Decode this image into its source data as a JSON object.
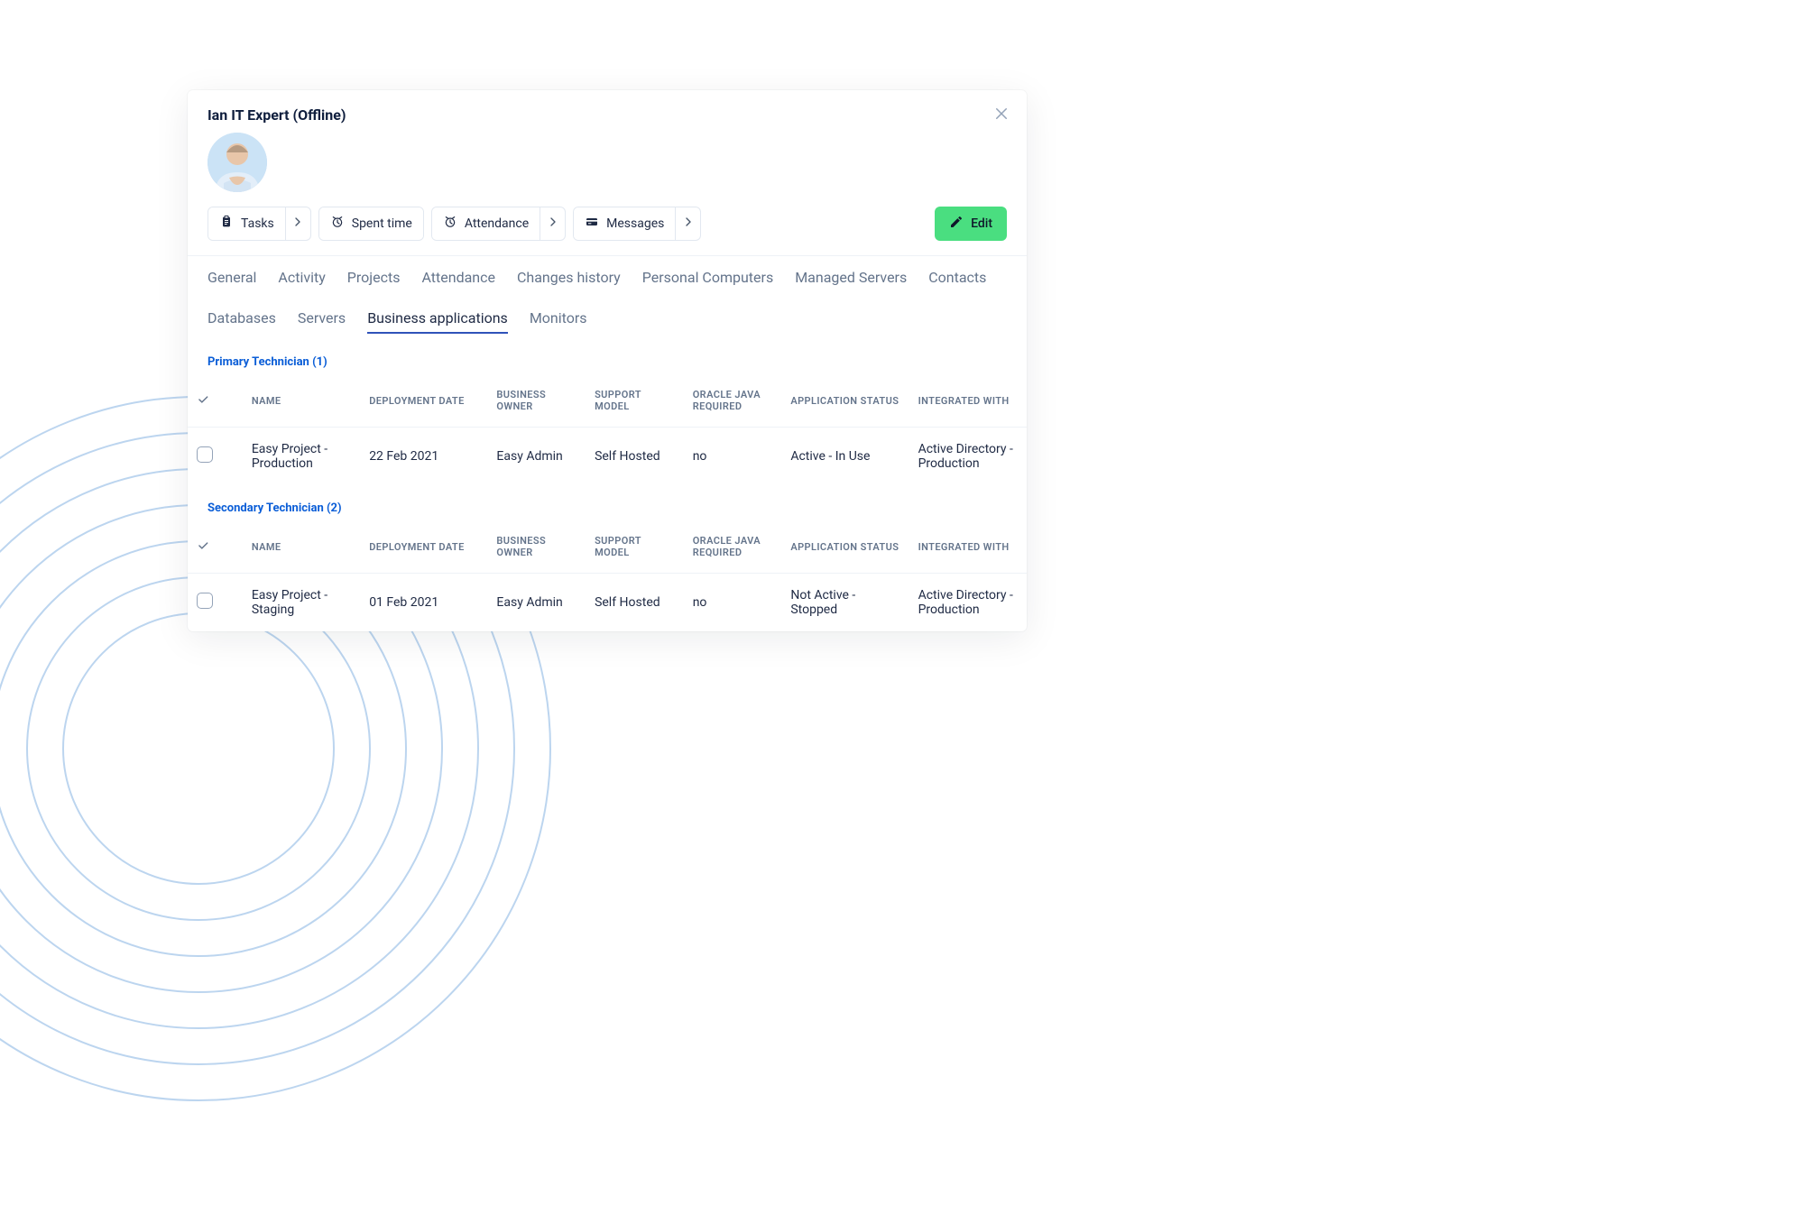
{
  "title": "Ian IT Expert (Offline)",
  "action_buttons": [
    {
      "name": "tasks-button",
      "icon": "clipboard-icon",
      "label": "Tasks",
      "has_caret": true
    },
    {
      "name": "spent-time-button",
      "icon": "clock-alarm-icon",
      "label": "Spent time",
      "has_caret": false
    },
    {
      "name": "attendance-button",
      "icon": "clock-alarm-icon",
      "label": "Attendance",
      "has_caret": true
    },
    {
      "name": "messages-button",
      "icon": "credit-card-icon",
      "label": "Messages",
      "has_caret": true
    }
  ],
  "edit_label": "Edit",
  "tabs": [
    {
      "label": "General",
      "active": false
    },
    {
      "label": "Activity",
      "active": false
    },
    {
      "label": "Projects",
      "active": false
    },
    {
      "label": "Attendance",
      "active": false
    },
    {
      "label": "Changes history",
      "active": false
    },
    {
      "label": "Personal Computers",
      "active": false
    },
    {
      "label": "Managed Servers",
      "active": false
    },
    {
      "label": "Contacts",
      "active": false
    },
    {
      "label": "Databases",
      "active": false
    },
    {
      "label": "Servers",
      "active": false
    },
    {
      "label": "Business applications",
      "active": true
    },
    {
      "label": "Monitors",
      "active": false
    }
  ],
  "sections": [
    {
      "title": "Primary Technician (1)",
      "columns": [
        "NAME",
        "DEPLOYMENT DATE",
        "BUSINESS OWNER",
        "SUPPORT MODEL",
        "ORACLE JAVA REQUIRED",
        "APPLICATION STATUS",
        "INTEGRATED WITH"
      ],
      "rows": [
        {
          "name": "Easy Project - Production",
          "deployment_date": "22 Feb 2021",
          "business_owner": "Easy Admin",
          "support_model": "Self Hosted",
          "oracle_java_required": "no",
          "application_status": "Active - In Use",
          "integrated_with": "Active Directory - Production"
        }
      ]
    },
    {
      "title": "Secondary Technician (2)",
      "columns": [
        "NAME",
        "DEPLOYMENT DATE",
        "BUSINESS OWNER",
        "SUPPORT MODEL",
        "ORACLE JAVA REQUIRED",
        "APPLICATION STATUS",
        "INTEGRATED WITH"
      ],
      "rows": [
        {
          "name": "Easy Project - Staging",
          "deployment_date": "01 Feb 2021",
          "business_owner": "Easy Admin",
          "support_model": "Self Hosted",
          "oracle_java_required": "no",
          "application_status": "Not Active - Stopped",
          "integrated_with": "Active Directory - Production"
        }
      ]
    }
  ]
}
